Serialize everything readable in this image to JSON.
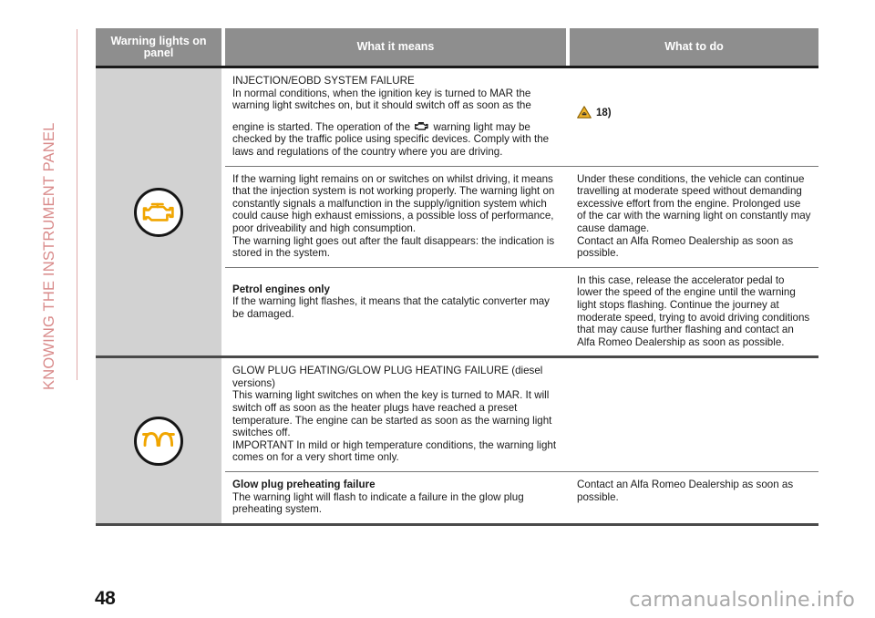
{
  "chapter_title": "KNOWING THE INSTRUMENT PANEL",
  "page_number": "48",
  "watermark": "carmanualsonline.info",
  "colors": {
    "header_bg": "#8e8e8e",
    "icon_cell_bg": "#d2d2d2",
    "chapter_title": "#d98b8b",
    "warning_yellow": "#F0A500",
    "rule_dark": "#1a1a1a"
  },
  "table": {
    "headers": {
      "col_icon": "Warning lights on panel",
      "col_means": "What it means",
      "col_todo": "What to do"
    },
    "groups": [
      {
        "icon": "engine-check-warning-light-icon",
        "rows": [
          {
            "means": [
              {
                "text": "INJECTION/EOBD SYSTEM FAILURE",
                "bold": false
              },
              {
                "text": "In normal conditions, when the ignition key is turned to MAR the warning light switches on, but it should switch off as soon as the",
                "bold": false
              },
              {
                "text_before_icon": "engine is started. The operation of the ",
                "inline_icon": "engine-check-icon",
                "text_after_icon": " warning light may be checked by the traffic police using specific devices. Comply with the laws and regulations of the country where you are driving.",
                "spaced": true
              }
            ],
            "todo_footnote": "18)",
            "todo": []
          },
          {
            "means": [
              {
                "text": "If the warning light remains on or switches on whilst driving, it means that the injection system is not working properly. The warning light on constantly signals a malfunction in the supply/ignition system which could cause high exhaust emissions, a possible loss of performance, poor driveability and high consumption.",
                "bold": false
              },
              {
                "text": "The warning light goes out after the fault disappears: the indication is stored in the system.",
                "bold": false
              }
            ],
            "todo": [
              {
                "text": "Under these conditions, the vehicle can continue travelling at moderate speed without demanding excessive effort from the engine. Prolonged use of the car with the warning light on constantly may cause damage.",
                "bold": false
              },
              {
                "text": "Contact an Alfa Romeo Dealership as soon as possible.",
                "bold": false
              }
            ]
          },
          {
            "means": [
              {
                "text": "Petrol engines only",
                "bold": true,
                "spaced": true
              },
              {
                "text": "If the warning light flashes, it means that the catalytic converter may be damaged.",
                "bold": false
              }
            ],
            "todo": [
              {
                "text": "In this case, release the accelerator pedal to lower the speed of the engine until the warning light stops flashing. Continue the journey at moderate speed, trying to avoid driving conditions that may cause further flashing and contact an Alfa Romeo Dealership as soon as possible.",
                "bold": false
              }
            ]
          }
        ]
      },
      {
        "icon": "glow-plug-warning-light-icon",
        "rows": [
          {
            "means": [
              {
                "text": "GLOW PLUG HEATING/GLOW PLUG HEATING FAILURE (diesel versions)",
                "bold": false
              },
              {
                "text": "This warning light switches on when the key is turned to MAR. It will switch off as soon as the heater plugs have reached a preset temperature. The engine can be started as soon as the warning light switches off.",
                "bold": false
              },
              {
                "text": "IMPORTANT In mild or high temperature conditions, the warning light comes on for a very short time only.",
                "bold": false
              }
            ],
            "todo": []
          },
          {
            "means": [
              {
                "text": "Glow plug preheating failure",
                "bold": true
              },
              {
                "text": "The warning light will flash to indicate a failure in the glow plug preheating system.",
                "bold": false
              }
            ],
            "todo": [
              {
                "text": "Contact an Alfa Romeo Dealership as soon as possible.",
                "bold": false
              }
            ]
          }
        ]
      }
    ]
  }
}
